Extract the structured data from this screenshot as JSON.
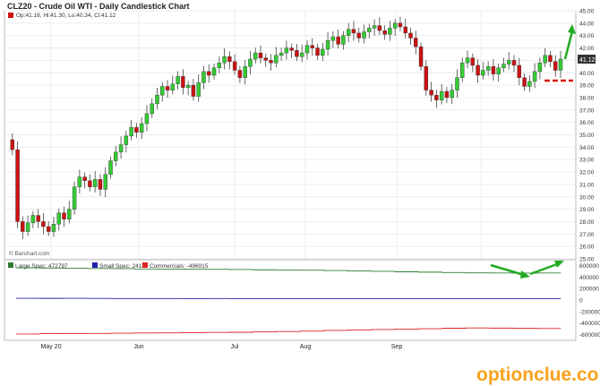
{
  "header": {
    "title": "CLZ20 - Crude Oil WTI - Daily Candlestick Chart",
    "ohlc": "Op:41.16, Hi:41.30, Lo:40.34, Cl:41.12",
    "current_price": "41.12",
    "source": "© Barchart.com"
  },
  "watermark": {
    "text": "optionclue.com",
    "color": "#f7a21b"
  },
  "colors": {
    "up": "#33cc33",
    "down": "#cc1111",
    "large_spec": "#2e7d32",
    "small_spec": "#2222aa",
    "commercials": "#dd2222",
    "annotation": "#22aa22",
    "support": "#dd1111"
  },
  "chart_data": [
    {
      "type": "candlestick",
      "title": "CLZ20 - Crude Oil WTI - Daily Candlestick Chart",
      "ylim": [
        25,
        45
      ],
      "y_ticks": [
        "25.00",
        "26.00",
        "27.00",
        "28.00",
        "29.00",
        "30.00",
        "31.00",
        "32.00",
        "33.00",
        "34.00",
        "35.00",
        "36.00",
        "37.00",
        "38.00",
        "39.00",
        "40.00",
        "41.00",
        "42.00",
        "43.00",
        "44.00",
        "45.00"
      ],
      "x_tick_labels": [
        "May 20",
        "Jun",
        "Jul",
        "Aug",
        "Sep"
      ],
      "close_path": [
        34.6,
        33.8,
        28.0,
        27.2,
        27.9,
        28.5,
        28.0,
        27.6,
        27.2,
        27.8,
        28.7,
        28.2,
        29.0,
        30.8,
        31.6,
        31.3,
        30.8,
        31.4,
        30.6,
        31.8,
        32.9,
        33.6,
        34.2,
        34.9,
        35.6,
        35.2,
        35.9,
        36.7,
        37.5,
        38.2,
        38.9,
        38.6,
        39.1,
        39.7,
        38.8,
        39.0,
        38.1,
        39.2,
        40.1,
        39.8,
        40.4,
        40.8,
        41.3,
        40.9,
        40.2,
        39.6,
        40.5,
        41.1,
        41.6,
        41.2,
        41.0,
        40.8,
        41.4,
        41.6,
        42.0,
        41.8,
        41.3,
        41.6,
        42.2,
        42.0,
        41.4,
        41.9,
        42.6,
        42.9,
        42.3,
        43.0,
        43.5,
        43.2,
        42.8,
        43.3,
        43.6,
        43.8,
        43.4,
        43.1,
        43.6,
        44.0,
        43.7,
        43.2,
        42.8,
        42.1,
        40.5,
        38.6,
        38.2,
        37.8,
        38.5,
        38.0,
        38.6,
        39.6,
        40.8,
        41.2,
        40.6,
        39.8,
        40.2,
        40.5,
        39.9,
        40.4,
        40.7,
        41.0,
        40.6,
        39.6,
        38.9,
        39.3,
        40.1,
        40.8,
        41.4,
        40.9,
        40.2,
        41.1
      ],
      "series": [
        {
          "name": "Large Spec",
          "legend_value": "472797"
        },
        {
          "name": "Small Spec",
          "legend_value": "24118"
        },
        {
          "name": "Commercials",
          "legend_value": "-496915"
        }
      ],
      "cot_ylim": [
        -700000,
        700000
      ],
      "cot_ticks": [
        "600000",
        "400000",
        "200000",
        "0",
        "-200000",
        "-400000",
        "-600000"
      ],
      "cot_path": {
        "large": [
          560000,
          555000,
          552000,
          548000,
          545000,
          540000,
          538000,
          536000,
          534000,
          530000,
          525000,
          522000,
          518000,
          512000,
          505000,
          498000,
          490000,
          484000,
          478000,
          472000,
          470000,
          468000,
          470000,
          472797
        ],
        "small": [
          30000,
          29000,
          30000,
          28000,
          27000,
          26000,
          27000,
          25000,
          26000,
          25000,
          24000,
          25000,
          24500,
          24118,
          24500,
          24000,
          24300,
          24118,
          24200,
          24118,
          24000,
          24118,
          24100,
          24118
        ],
        "commercials": [
          -590000,
          -585000,
          -583000,
          -580000,
          -576000,
          -573000,
          -570000,
          -566000,
          -563000,
          -560000,
          -553000,
          -547000,
          -540000,
          -528000,
          -520000,
          -512000,
          -505000,
          -498000,
          -490000,
          -485000,
          -488000,
          -492000,
          -495000,
          -496915
        ]
      }
    }
  ]
}
